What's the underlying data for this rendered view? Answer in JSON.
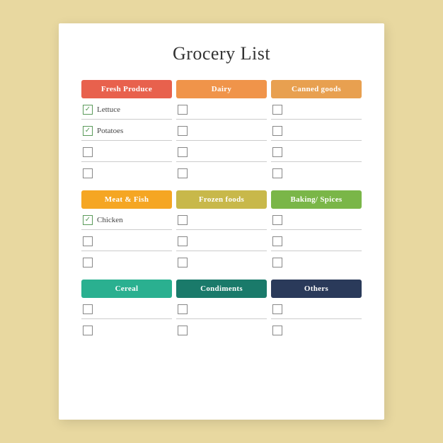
{
  "title": "Grocery List",
  "sections": [
    {
      "id": "section1",
      "headers": [
        {
          "label": "Fresh Produce",
          "colorClass": "header-fresh"
        },
        {
          "label": "Dairy",
          "colorClass": "header-dairy"
        },
        {
          "label": "Canned goods",
          "colorClass": "header-canned"
        }
      ],
      "rows": [
        [
          {
            "checked": true,
            "label": "Lettuce"
          },
          {
            "checked": false,
            "label": ""
          },
          {
            "checked": false,
            "label": ""
          }
        ],
        [
          {
            "checked": true,
            "label": "Potatoes"
          },
          {
            "checked": false,
            "label": ""
          },
          {
            "checked": false,
            "label": ""
          }
        ],
        [
          {
            "checked": false,
            "label": ""
          },
          {
            "checked": false,
            "label": ""
          },
          {
            "checked": false,
            "label": ""
          }
        ],
        [
          {
            "checked": false,
            "label": ""
          },
          {
            "checked": false,
            "label": ""
          },
          {
            "checked": false,
            "label": ""
          }
        ]
      ]
    },
    {
      "id": "section2",
      "headers": [
        {
          "label": "Meat & Fish",
          "colorClass": "header-meat"
        },
        {
          "label": "Frozen foods",
          "colorClass": "header-frozen"
        },
        {
          "label": "Baking/ Spices",
          "colorClass": "header-baking"
        }
      ],
      "rows": [
        [
          {
            "checked": true,
            "label": "Chicken"
          },
          {
            "checked": false,
            "label": ""
          },
          {
            "checked": false,
            "label": ""
          }
        ],
        [
          {
            "checked": false,
            "label": ""
          },
          {
            "checked": false,
            "label": ""
          },
          {
            "checked": false,
            "label": ""
          }
        ],
        [
          {
            "checked": false,
            "label": ""
          },
          {
            "checked": false,
            "label": ""
          },
          {
            "checked": false,
            "label": ""
          }
        ]
      ]
    },
    {
      "id": "section3",
      "headers": [
        {
          "label": "Cereal",
          "colorClass": "header-cereal"
        },
        {
          "label": "Condiments",
          "colorClass": "header-condiments"
        },
        {
          "label": "Others",
          "colorClass": "header-others"
        }
      ],
      "rows": [
        [
          {
            "checked": false,
            "label": ""
          },
          {
            "checked": false,
            "label": ""
          },
          {
            "checked": false,
            "label": ""
          }
        ],
        [
          {
            "checked": false,
            "label": ""
          },
          {
            "checked": false,
            "label": ""
          },
          {
            "checked": false,
            "label": ""
          }
        ]
      ]
    }
  ]
}
